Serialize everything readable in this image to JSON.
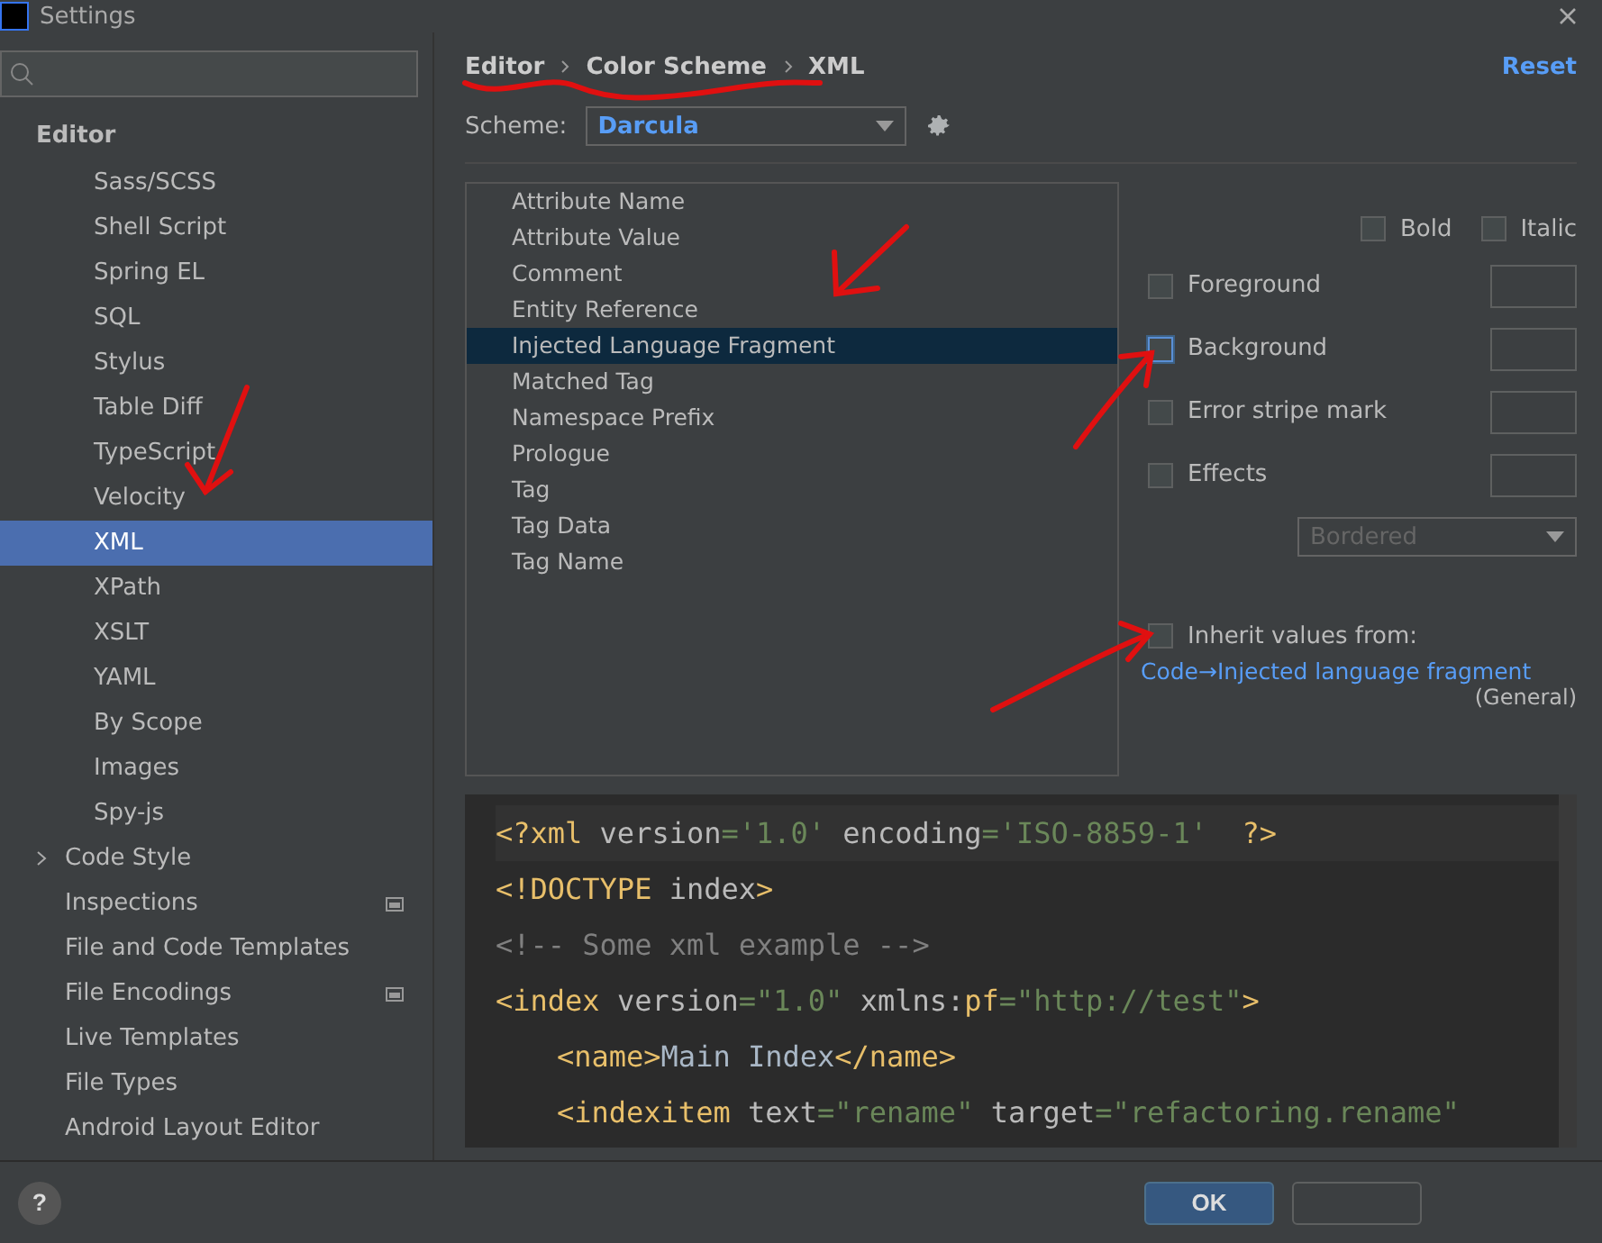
{
  "window": {
    "title": "Settings"
  },
  "sidebar": {
    "section": "Editor",
    "nested_items": [
      {
        "label": "Sass/SCSS",
        "selected": false
      },
      {
        "label": "Shell Script",
        "selected": false
      },
      {
        "label": "Spring EL",
        "selected": false
      },
      {
        "label": "SQL",
        "selected": false
      },
      {
        "label": "Stylus",
        "selected": false
      },
      {
        "label": "Table Diff",
        "selected": false
      },
      {
        "label": "TypeScript",
        "selected": false
      },
      {
        "label": "Velocity",
        "selected": false
      },
      {
        "label": "XML",
        "selected": true
      },
      {
        "label": "XPath",
        "selected": false
      },
      {
        "label": "XSLT",
        "selected": false
      },
      {
        "label": "YAML",
        "selected": false
      },
      {
        "label": "By Scope",
        "selected": false
      },
      {
        "label": "Images",
        "selected": false
      },
      {
        "label": "Spy-js",
        "selected": false
      }
    ],
    "items": [
      {
        "label": "Code Style",
        "expandable": true,
        "project_level": false
      },
      {
        "label": "Inspections",
        "expandable": false,
        "project_level": true
      },
      {
        "label": "File and Code Templates",
        "expandable": false,
        "project_level": false
      },
      {
        "label": "File Encodings",
        "expandable": false,
        "project_level": true
      },
      {
        "label": "Live Templates",
        "expandable": false,
        "project_level": false
      },
      {
        "label": "File Types",
        "expandable": false,
        "project_level": false
      },
      {
        "label": "Android Layout Editor",
        "expandable": false,
        "project_level": false
      }
    ]
  },
  "breadcrumb": [
    "Editor",
    "Color Scheme",
    "XML"
  ],
  "reset_link": "Reset",
  "scheme": {
    "label": "Scheme:",
    "value": "Darcula"
  },
  "attributes": [
    {
      "label": "Attribute Name",
      "selected": false
    },
    {
      "label": "Attribute Value",
      "selected": false
    },
    {
      "label": "Comment",
      "selected": false
    },
    {
      "label": "Entity Reference",
      "selected": false
    },
    {
      "label": "Injected Language Fragment",
      "selected": true
    },
    {
      "label": "Matched Tag",
      "selected": false
    },
    {
      "label": "Namespace Prefix",
      "selected": false
    },
    {
      "label": "Prologue",
      "selected": false
    },
    {
      "label": "Tag",
      "selected": false
    },
    {
      "label": "Tag Data",
      "selected": false
    },
    {
      "label": "Tag Name",
      "selected": false
    }
  ],
  "font_styles": [
    {
      "label": "Bold",
      "checked": false
    },
    {
      "label": "Italic",
      "checked": false
    }
  ],
  "color_options": [
    {
      "label": "Foreground",
      "checked": false,
      "focused": false
    },
    {
      "label": "Background",
      "checked": false,
      "focused": true
    },
    {
      "label": "Error stripe mark",
      "checked": false,
      "focused": false
    },
    {
      "label": "Effects",
      "checked": false,
      "focused": false
    }
  ],
  "effect_type": {
    "value": "Bordered",
    "disabled": true
  },
  "inherit": {
    "label": "Inherit values from:",
    "checked": false,
    "link": "Code→Injected language fragment",
    "scope": "(General)"
  },
  "preview": [
    [
      {
        "kind": "tag",
        "text": "<?xml "
      },
      {
        "kind": "attr",
        "text": "version"
      },
      {
        "kind": "value",
        "text": "='1.0' "
      },
      {
        "kind": "attr",
        "text": "encoding"
      },
      {
        "kind": "value",
        "text": "='ISO-8859-1'  "
      },
      {
        "kind": "tag",
        "text": "?>"
      }
    ],
    [
      {
        "kind": "tag",
        "text": "<!DOCTYPE "
      },
      {
        "kind": "attr",
        "text": "index"
      },
      {
        "kind": "tag",
        "text": ">"
      }
    ],
    [
      {
        "kind": "comment",
        "text": "<!-- Some xml example -->"
      }
    ],
    [
      {
        "kind": "tag",
        "text": "<index "
      },
      {
        "kind": "attr",
        "text": "version"
      },
      {
        "kind": "value",
        "text": "=\"1.0\" "
      },
      {
        "kind": "attr",
        "text": "xmlns:"
      },
      {
        "kind": "tag",
        "text": "pf"
      },
      {
        "kind": "value",
        "text": "=\"http://test\""
      },
      {
        "kind": "tag",
        "text": ">"
      }
    ],
    [
      {
        "kind": "tag",
        "text": "<name>",
        "indented": true
      },
      {
        "kind": "text",
        "text": "Main Index"
      },
      {
        "kind": "tag",
        "text": "</name>"
      }
    ],
    [
      {
        "kind": "tag",
        "text": "<indexitem ",
        "indented": true
      },
      {
        "kind": "attr",
        "text": "text"
      },
      {
        "kind": "value",
        "text": "=\"rename\" "
      },
      {
        "kind": "attr",
        "text": "target"
      },
      {
        "kind": "value",
        "text": "=\"refactoring.rename\""
      }
    ]
  ],
  "help_button": "?",
  "buttons": [
    {
      "label": "OK",
      "default": true
    },
    {
      "default": false
    }
  ]
}
